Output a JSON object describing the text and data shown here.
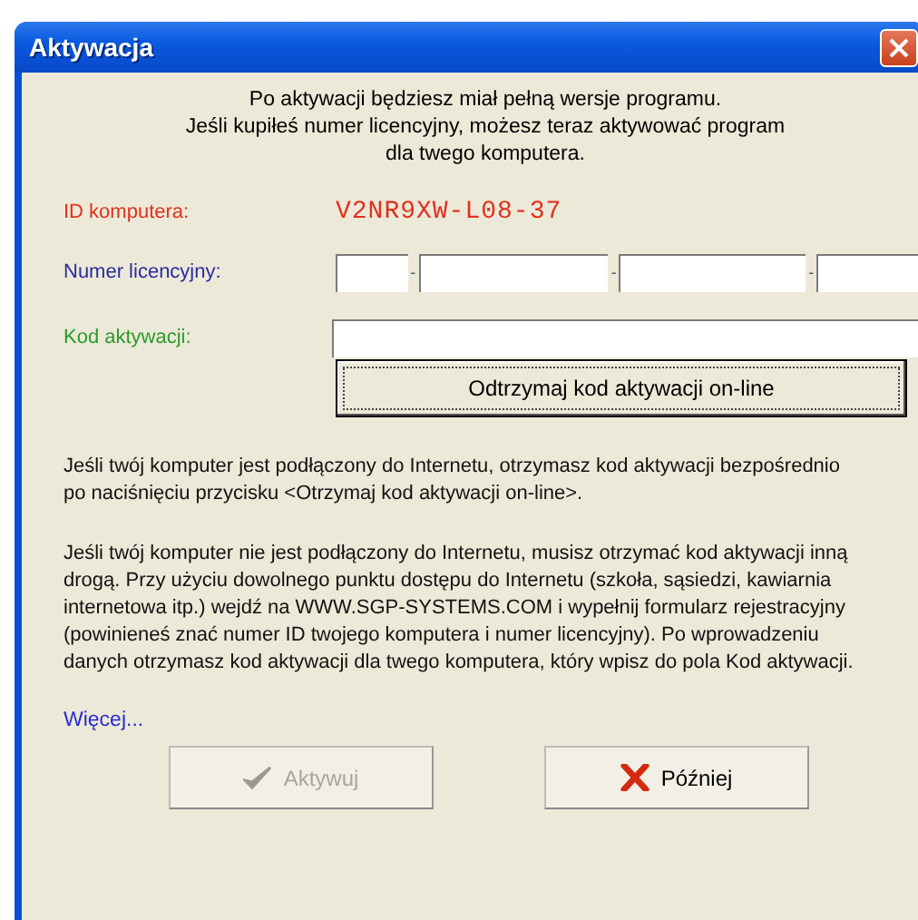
{
  "window": {
    "title": "Aktywacja"
  },
  "intro": [
    "Po aktywacji będziesz miał pełną wersje programu.",
    "Jeśli kupiłeś numer licencyjny, możesz teraz aktywować program",
    "dla twego komputera."
  ],
  "computer_id": {
    "label": "ID komputera:",
    "value": "V2NR9XW-L08-37"
  },
  "license_number": {
    "label": "Numer licencyjny:",
    "separators": [
      "-",
      "-",
      "-"
    ]
  },
  "activation_code": {
    "label": "Kod aktywacji:"
  },
  "online_button": {
    "label": "Odtrzymaj kod aktywacji on-line"
  },
  "paragraphs": [
    "Jeśli twój komputer jest podłączony do Internetu, otrzymasz kod aktywacji bezpośrednio po naciśnięciu przycisku <Otrzymaj kod aktywacji on-line>.",
    "Jeśli twój komputer nie jest podłączony do Internetu, musisz otrzymać kod aktywacji inną drogą. Przy użyciu dowolnego punktu dostępu do Internetu (szkoła, sąsiedzi, kawiarnia internetowa itp.) wejdź na WWW.SGP-SYSTEMS.COM i wypełnij formularz rejestracyjny (powinieneś znać numer ID twojego komputera i numer licencyjny). Po wprowadzeniu danych otrzymasz kod aktywacji dla twego komputera, który wpisz do pola Kod aktywacji."
  ],
  "more_link": "Więcej...",
  "buttons": [
    {
      "kind": "confirm",
      "label": "Aktywuj",
      "disabled": true
    },
    {
      "kind": "cancel",
      "label": "Później",
      "disabled": false
    }
  ]
}
